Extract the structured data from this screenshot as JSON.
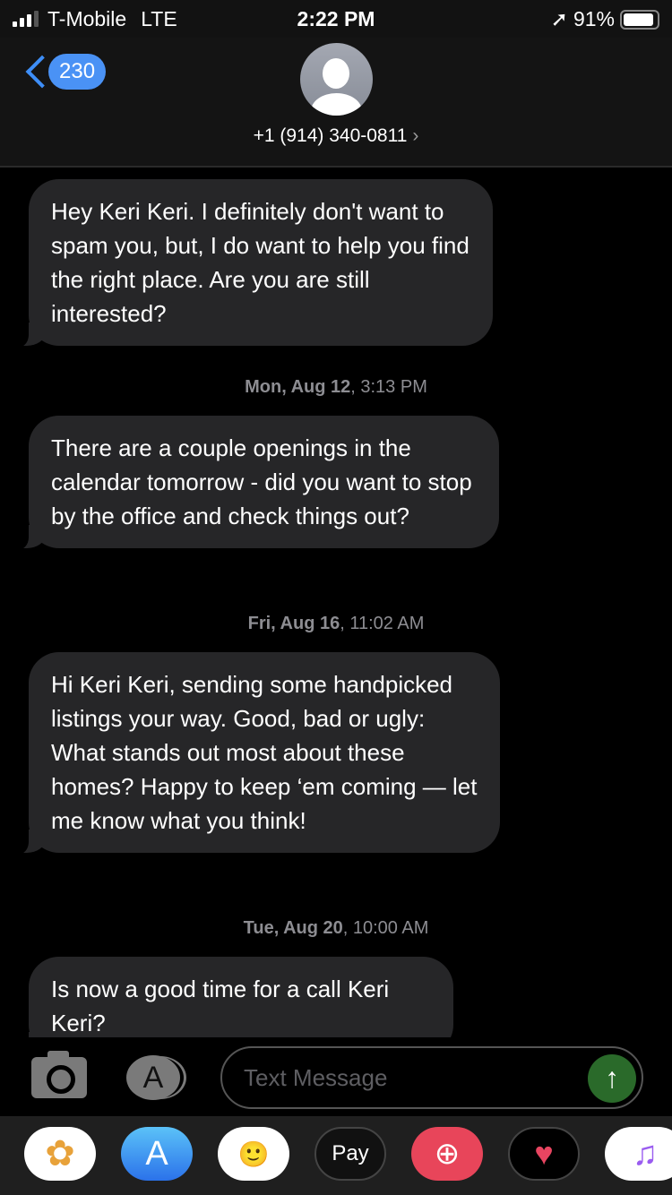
{
  "status_bar": {
    "carrier": "T-Mobile",
    "network": "LTE",
    "time": "2:22 PM",
    "battery": "91%",
    "battery_level": 0.91
  },
  "header": {
    "back_count": "230",
    "contact": "+1 (914) 340-0811"
  },
  "messages": [
    {
      "type": "received",
      "text": "Hey Keri Keri. I definitely don't want to spam you, but, I do want to help you find the right place. Are you are still interested?"
    },
    {
      "type": "timestamp",
      "day": "Mon, Aug 12",
      "time": ", 3:13 PM"
    },
    {
      "type": "received",
      "text": "There are a couple openings in the calendar tomorrow - did you want to stop by the office and check things out?"
    },
    {
      "type": "timestamp",
      "day": "Fri, Aug 16",
      "time": ", 11:02 AM"
    },
    {
      "type": "received",
      "text": "Hi Keri Keri, sending some handpicked listings your way. Good, bad or ugly: What stands out most about these homes? Happy to keep ‘em coming — let me know what you think!"
    },
    {
      "type": "timestamp",
      "day": "Tue, Aug 20",
      "time": ", 10:00 AM"
    },
    {
      "type": "received",
      "text": "Is now a good time for a call Keri Keri?"
    }
  ],
  "composer": {
    "placeholder": "Text Message",
    "send_color": "#2a6a2a"
  },
  "app_drawer": [
    {
      "icon": "photos-icon"
    },
    {
      "icon": "app-store-icon"
    },
    {
      "icon": "memoji-icon"
    },
    {
      "icon": "apple-pay-icon",
      "label": "Pay"
    },
    {
      "icon": "web-search-icon"
    },
    {
      "icon": "heart-app-icon"
    },
    {
      "icon": "music-icon"
    }
  ]
}
